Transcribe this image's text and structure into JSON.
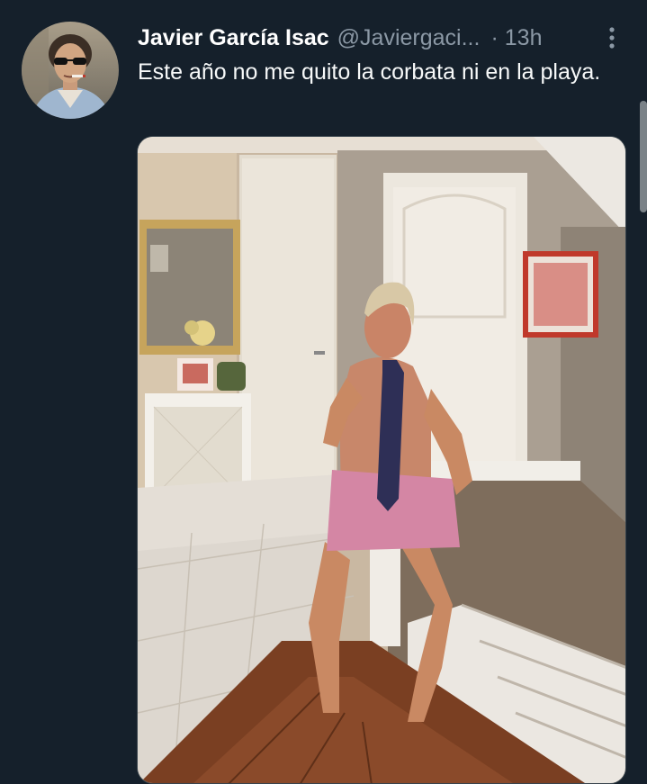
{
  "tweet": {
    "author_name": "Javier García Isac",
    "author_handle": "@Javiergaci...",
    "separator": "·",
    "timestamp": "13h",
    "text": "Este año no me quito la corbata ni en la playa."
  },
  "icons": {
    "more": "more-vertical-icon",
    "avatar": "user-avatar"
  },
  "colors": {
    "background": "#15202b",
    "primary_text": "#f7f9f9",
    "secondary_text": "#8b98a5",
    "border": "#38444d"
  }
}
